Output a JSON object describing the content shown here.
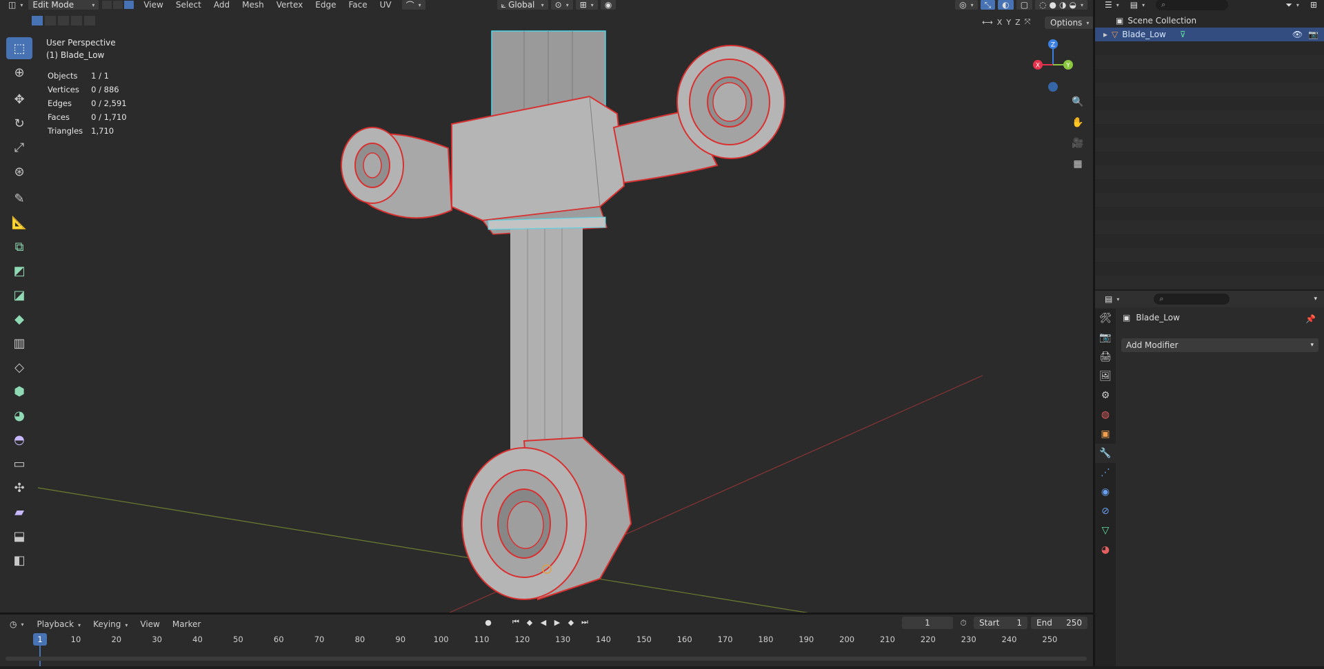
{
  "viewport": {
    "header": {
      "editor_type_icon": "cube-editor-icon",
      "mode": "Edit Mode",
      "menus": [
        "View",
        "Select",
        "Add",
        "Mesh",
        "Vertex",
        "Edge",
        "Face",
        "UV"
      ],
      "orientation": "Global",
      "options_label": "Options",
      "axis_labels": [
        "X",
        "Y",
        "Z"
      ]
    },
    "overlay": {
      "perspective": "User Perspective",
      "object": "(1) Blade_Low"
    },
    "stats": [
      {
        "label": "Objects",
        "value": "1 / 1"
      },
      {
        "label": "Vertices",
        "value": "0 / 886"
      },
      {
        "label": "Edges",
        "value": "0 / 2,591"
      },
      {
        "label": "Faces",
        "value": "0 / 1,710"
      },
      {
        "label": "Triangles",
        "value": "1,710"
      }
    ],
    "gizmo": {
      "x": "X",
      "y": "Y",
      "z": "Z",
      "colors": {
        "x": "#e5334d",
        "y": "#8bc63f",
        "z": "#3d7fe0"
      }
    },
    "tools": [
      "select-box-icon",
      "cursor-icon",
      "move-icon",
      "rotate-icon",
      "scale-icon",
      "transform-icon",
      "annotate-icon",
      "measure-icon",
      "add-cube-icon",
      "extrude-icon",
      "inset-icon",
      "bevel-icon",
      "loop-cut-icon",
      "knife-icon",
      "poly-build-icon",
      "spin-icon",
      "smooth-icon",
      "edge-slide-icon",
      "shrink-fatten-icon",
      "shear-icon",
      "rip-icon",
      "rip-edge-icon"
    ]
  },
  "timeline": {
    "menus": [
      "Playback",
      "Keying",
      "View",
      "Marker"
    ],
    "current_frame": "1",
    "start_label": "Start",
    "start_value": "1",
    "end_label": "End",
    "end_value": "250",
    "ruler": [
      "1",
      "10",
      "20",
      "30",
      "40",
      "50",
      "60",
      "70",
      "80",
      "90",
      "100",
      "110",
      "120",
      "130",
      "140",
      "150",
      "160",
      "170",
      "180",
      "190",
      "200",
      "210",
      "220",
      "230",
      "240",
      "250"
    ]
  },
  "outliner": {
    "scene_collection": "Scene Collection",
    "object_name": "Blade_Low"
  },
  "properties": {
    "object_name": "Blade_Low",
    "add_modifier": "Add Modifier"
  },
  "colors": {
    "accent": "#4772b3",
    "selected_row": "#334d80",
    "wire_red": "#d8302f"
  }
}
